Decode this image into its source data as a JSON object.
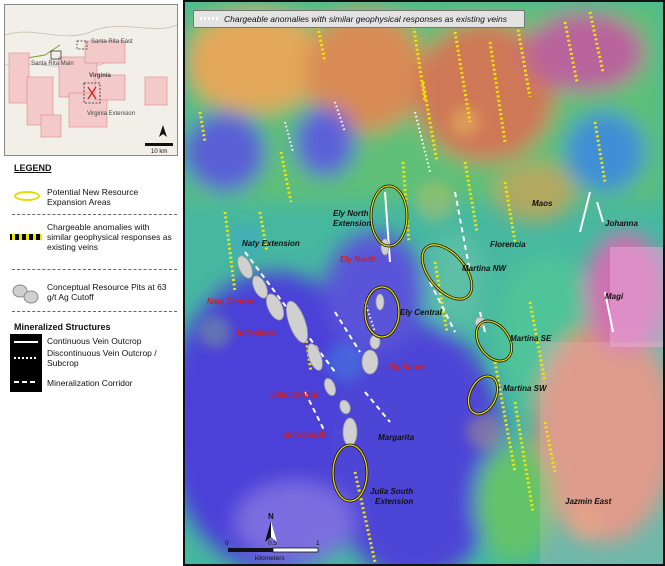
{
  "banner": {
    "text": "Chargeable anomalies with similar geophysical responses as existing veins"
  },
  "inset": {
    "labels": {
      "santa_rita_east": "Santa Rita East",
      "santa_rita_main": "Santa Rita Main",
      "virginia": "Virginia",
      "virginia_extension": "Virginia Extension"
    },
    "scale_bar": "10 km",
    "claims_color": "#f4c9c9"
  },
  "legend": {
    "title": "LEGEND",
    "items": [
      {
        "icon": "yellow-ellipse-icon",
        "label": "Potential New Resource Expansion Areas"
      },
      {
        "icon": "yellow-dotted-line-icon",
        "label": "Chargeable anomalies with similar geophysical responses as existing veins"
      },
      {
        "icon": "gray-pit-icon",
        "label": "Conceptual Resource Pits at 63 g/t Ag Cutoff"
      }
    ],
    "structures_title": "Mineralized Structures",
    "structures": [
      {
        "icon": "solid-white-line-icon",
        "label": "Continuous Vein Outcrop"
      },
      {
        "icon": "dotted-white-line-icon",
        "label": "Discontinuous Vein Outcrop / Subcrop"
      },
      {
        "icon": "dashed-white-line-icon",
        "label": "Mineralization Corridor"
      }
    ]
  },
  "map_labels": {
    "black": [
      "Ely North Extension",
      "Naty Extension",
      "Ely Central",
      "Florencia",
      "Maos",
      "Johanna",
      "Martina NW",
      "Magi",
      "Martina SE",
      "Martina SW",
      "Margarita",
      "Julia South Extension",
      "Jazmin East"
    ],
    "red": [
      "Ely North",
      "Naty Central",
      "Julia North",
      "Ely South",
      "Julia Central",
      "Julia South"
    ]
  },
  "scale": {
    "ticks": [
      "0",
      "0.5",
      "1"
    ],
    "unit": "kilometers",
    "north": "N"
  },
  "colors": {
    "anomaly_yellow": "#f2e600",
    "ellipse": "#e8da00",
    "red_label": "#d21d1d",
    "pit_gray": "#d0d0d0"
  }
}
